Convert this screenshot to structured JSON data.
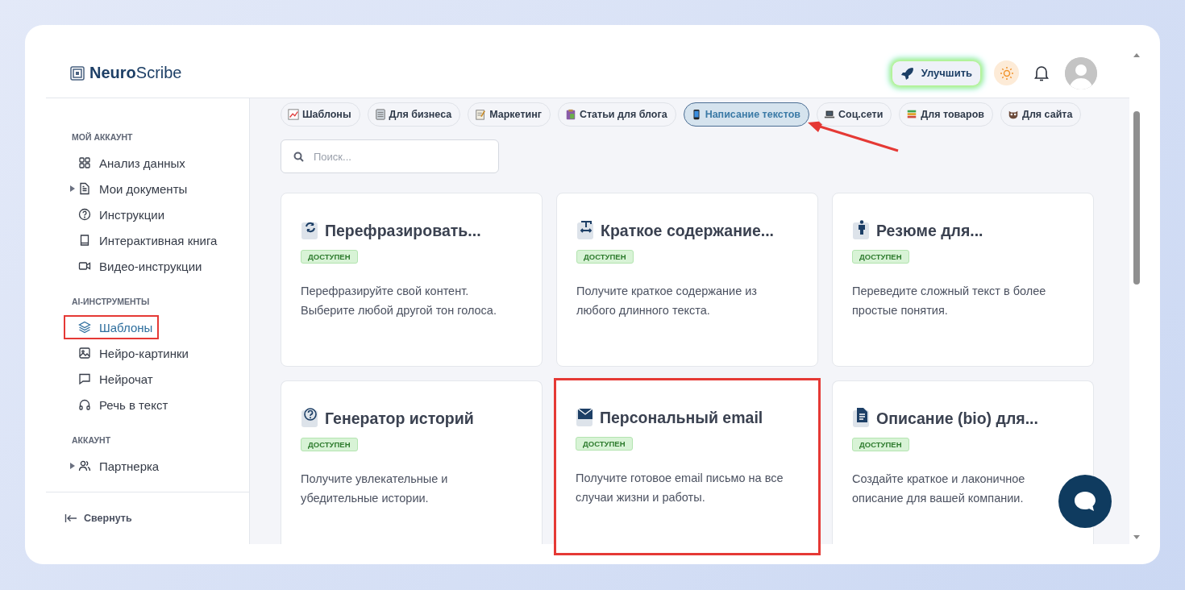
{
  "logo": "**Neuro**Scribe",
  "header": {
    "upgrade_button": "Улучшить"
  },
  "sidebar": {
    "sections": [
      {
        "title": "МОЙ АККАУНТ",
        "items": [
          {
            "label": "Анализ данных",
            "expandable": false,
            "selected": false,
            "highlighted": false
          },
          {
            "label": "Мои документы",
            "expandable": true,
            "selected": false,
            "highlighted": false
          },
          {
            "label": "Инструкции",
            "expandable": false,
            "selected": false,
            "highlighted": false
          },
          {
            "label": "Интерактивная книга",
            "expandable": false,
            "selected": false,
            "highlighted": false
          },
          {
            "label": "Видео-инструкции",
            "expandable": false,
            "selected": false,
            "highlighted": false
          }
        ]
      },
      {
        "title": "AI-ИНСТРУМЕНТЫ",
        "items": [
          {
            "label": "Шаблоны",
            "expandable": false,
            "selected": true,
            "highlighted": true
          },
          {
            "label": "Нейро-картинки",
            "expandable": false,
            "selected": false,
            "highlighted": false
          },
          {
            "label": "Нейрочат",
            "expandable": false,
            "selected": false,
            "highlighted": false
          },
          {
            "label": "Речь в текст",
            "expandable": false,
            "selected": false,
            "highlighted": false
          }
        ]
      },
      {
        "title": "АККАУНТ",
        "items": [
          {
            "label": "Партнерка",
            "expandable": true,
            "selected": false,
            "highlighted": false
          }
        ]
      }
    ],
    "collapse": "Свернуть"
  },
  "categories": [
    {
      "label": "Шаблоны",
      "selected": false,
      "pointed": false
    },
    {
      "label": "Для бизнеса",
      "selected": false,
      "pointed": false
    },
    {
      "label": "Маркетинг",
      "selected": false,
      "pointed": false
    },
    {
      "label": "Статьи для блога",
      "selected": false,
      "pointed": false
    },
    {
      "label": "Написание текстов",
      "selected": true,
      "pointed": true
    },
    {
      "label": "Соц.сети",
      "selected": false,
      "pointed": false
    },
    {
      "label": "Для товаров",
      "selected": false,
      "pointed": false
    },
    {
      "label": "Для сайта",
      "selected": false,
      "pointed": false
    }
  ],
  "search": {
    "placeholder": "Поиск..."
  },
  "templates": [
    {
      "title": "Перефразировать...",
      "badge": "ДОСТУПЕН",
      "description": "Перефразируйте свой контент. Выберите любой другой тон голоса.",
      "highlighted": false
    },
    {
      "title": "Краткое содержание...",
      "badge": "ДОСТУПЕН",
      "description": "Получите краткое содержание из любого длинного текста.",
      "highlighted": false
    },
    {
      "title": "Резюме для...",
      "badge": "ДОСТУПЕН",
      "description": "Переведите сложный текст в более простые понятия.",
      "highlighted": false
    },
    {
      "title": "Генератор историй",
      "badge": "ДОСТУПЕН",
      "description": "Получите увлекательные и убедительные истории.",
      "highlighted": false
    },
    {
      "title": "Персональный email",
      "badge": "ДОСТУПЕН",
      "description": "Получите готовое email письмо на все случаи жизни и работы.",
      "highlighted": true
    },
    {
      "title": "Описание (bio) для...",
      "badge": "ДОСТУПЕН",
      "description": "Создайте краткое и лаконичное описание для вашей компании.",
      "highlighted": false
    }
  ]
}
